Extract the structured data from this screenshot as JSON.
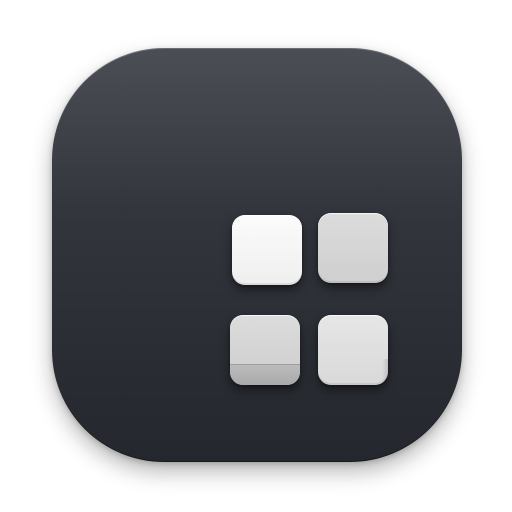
{
  "app_icon": {
    "icon": "four-square-grid-icon",
    "colors": {
      "background_top": "#4b4e55",
      "background_bottom": "#24272d",
      "tile_light": "#f5f5f5",
      "tile_gray": "#d4d4d4",
      "tile_band": "#b0b0b0"
    },
    "tiles": [
      {
        "position": "top-left",
        "tone": "light"
      },
      {
        "position": "top-right",
        "tone": "gray"
      },
      {
        "position": "bottom-left",
        "tone": "gray-with-bottom-band"
      },
      {
        "position": "bottom-right",
        "tone": "gray"
      }
    ]
  }
}
